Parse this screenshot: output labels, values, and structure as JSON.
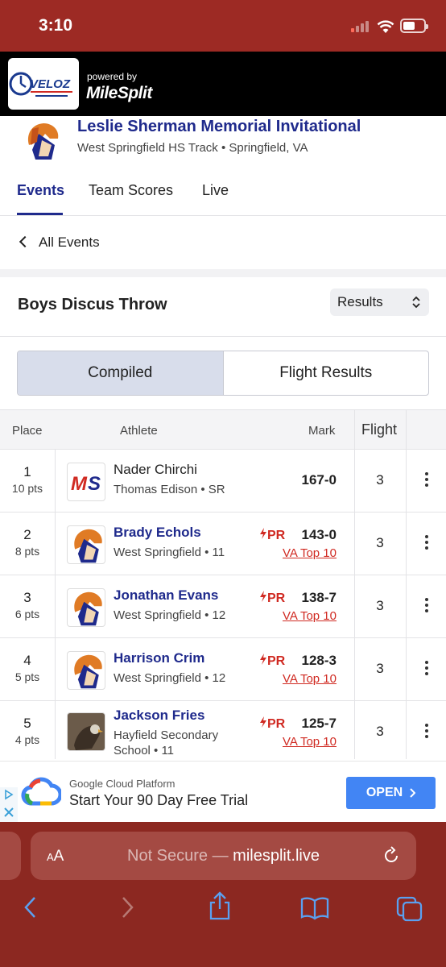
{
  "status_bar": {
    "time": "3:10"
  },
  "brand": {
    "powered_by": "powered by",
    "milesplit": "MileSplit",
    "veloz": "VELOZ"
  },
  "meet": {
    "title": "Leslie Sherman Memorial Invitational",
    "subtitle": "West Springfield HS Track • Springfield, VA"
  },
  "tabs": [
    {
      "label": "Events",
      "active": true
    },
    {
      "label": "Team Scores",
      "active": false
    },
    {
      "label": "Live",
      "active": false
    }
  ],
  "back_label": "All Events",
  "event": {
    "title": "Boys Discus Throw",
    "view_select": "Results"
  },
  "toggle": {
    "compiled": "Compiled",
    "flight_results": "Flight Results"
  },
  "table": {
    "headers": {
      "place": "Place",
      "athlete": "Athlete",
      "mark": "Mark",
      "flight": "Flight"
    },
    "rows": [
      {
        "place": "1",
        "pts": "10 pts",
        "name": "Nader Chirchi",
        "school": "Thomas Edison • SR",
        "pr": "",
        "mark": "167-0",
        "top10": "",
        "flight": "3",
        "avatar": "ms-logo",
        "link": false
      },
      {
        "place": "2",
        "pts": "8 pts",
        "name": "Brady Echols",
        "school": "West Springfield • 11",
        "pr": "PR",
        "mark": "143-0",
        "top10": "VA Top 10",
        "flight": "3",
        "avatar": "spartan",
        "link": true
      },
      {
        "place": "3",
        "pts": "6 pts",
        "name": "Jonathan Evans",
        "school": "West Springfield • 12",
        "pr": "PR",
        "mark": "138-7",
        "top10": "VA Top 10",
        "flight": "3",
        "avatar": "spartan",
        "link": true
      },
      {
        "place": "4",
        "pts": "5 pts",
        "name": "Harrison Crim",
        "school": "West Springfield • 12",
        "pr": "PR",
        "mark": "128-3",
        "top10": "VA Top 10",
        "flight": "3",
        "avatar": "spartan",
        "link": true
      },
      {
        "place": "5",
        "pts": "4 pts",
        "name": "Jackson Fries",
        "school": "Hayfield Secondary",
        "school2": "School • 11",
        "pr": "PR",
        "mark": "125-7",
        "top10": "VA Top 10",
        "flight": "3",
        "avatar": "hawk",
        "link": true
      }
    ]
  },
  "ad": {
    "brand": "Google Cloud Platform",
    "title": "Start Your 90 Day Free Trial",
    "cta": "OPEN"
  },
  "browser": {
    "aa": "AA",
    "not_secure": "Not Secure —",
    "domain": "milesplit.live"
  },
  "colors": {
    "status_bar": "#9d2a24",
    "primary": "#1f2a8c",
    "pr_red": "#d02a22",
    "safari": "#8c2821"
  }
}
